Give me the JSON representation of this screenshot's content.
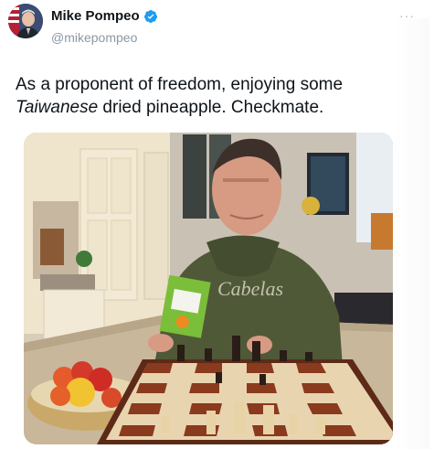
{
  "author": {
    "display_name": "Mike Pompeo",
    "handle": "@mikepompeo",
    "verified": true,
    "avatar_icon": "profile-photo"
  },
  "more_label": "···",
  "tweet": {
    "text_before": "As a proponent of freedom, enjoying some ",
    "text_italic": "Taiwanese",
    "text_after": " dried pineapple. Checkmate."
  },
  "media": {
    "description_icon": "photo",
    "package_label": "Cabelas"
  },
  "colors": {
    "verified_blue": "#1d9bf0",
    "handle_gray": "#8b98a5",
    "text": "#0f1419"
  }
}
